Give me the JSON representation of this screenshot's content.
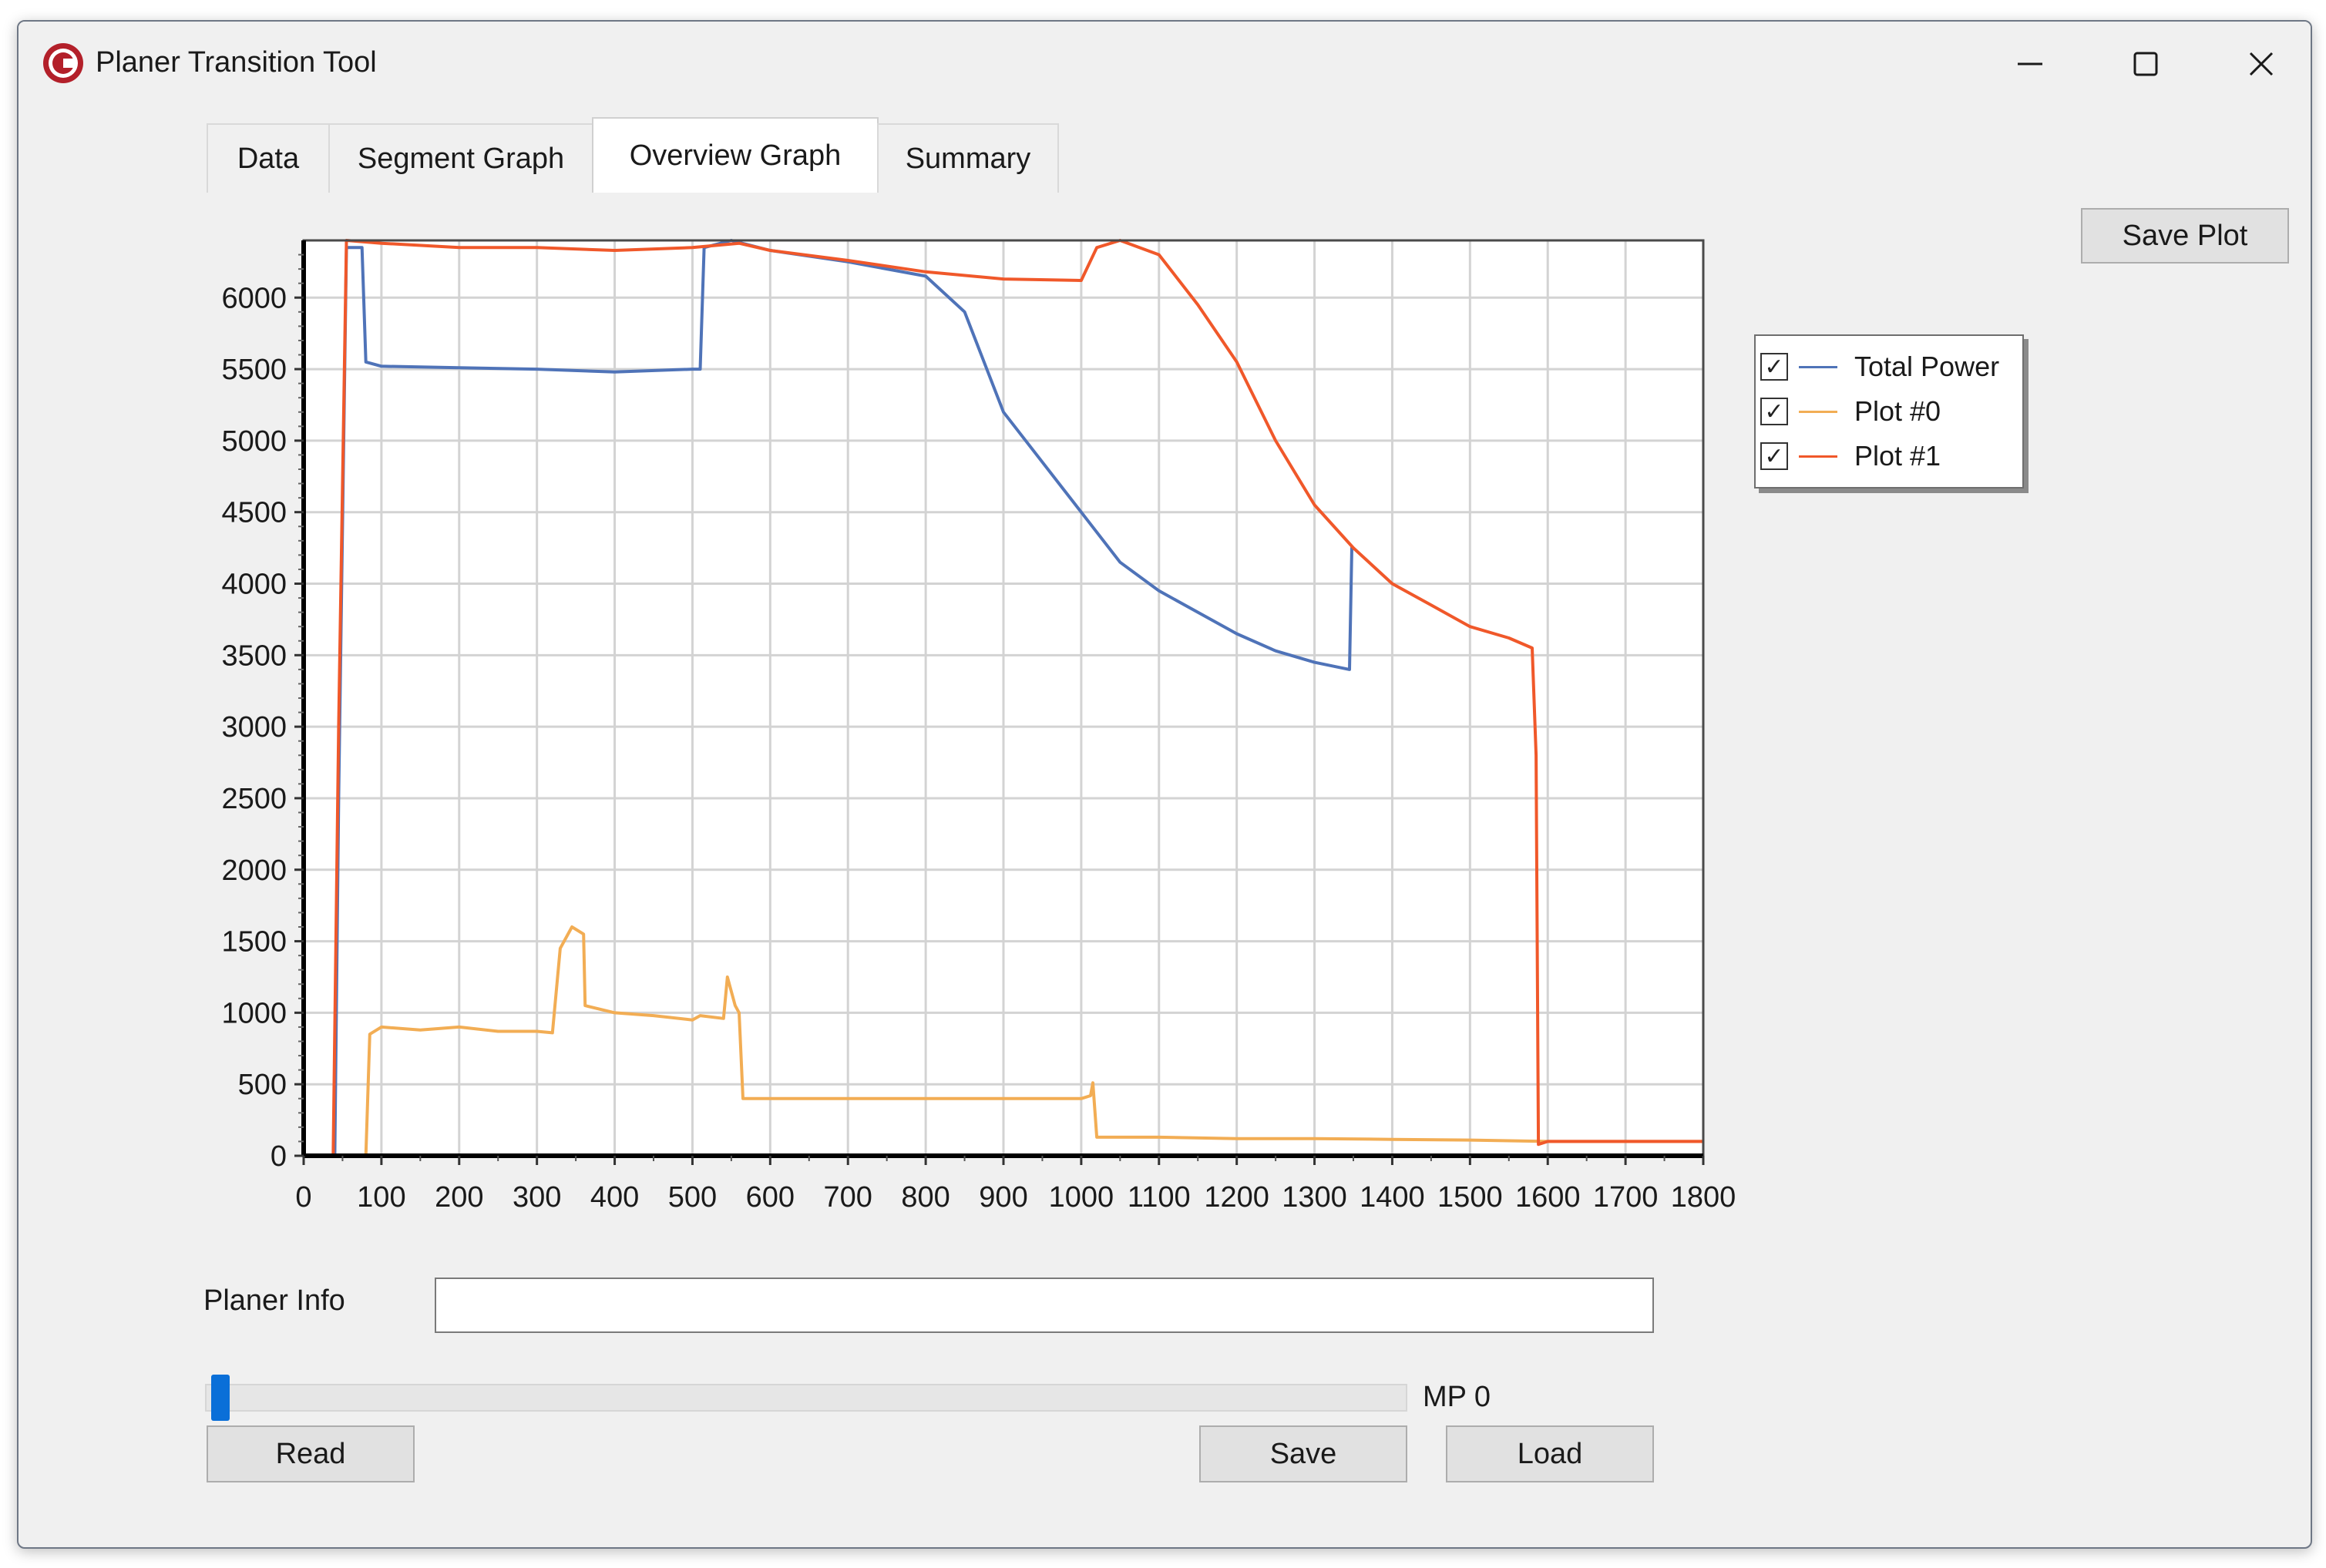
{
  "window": {
    "title": "Planer Transition Tool"
  },
  "tabs": [
    {
      "label": "Data",
      "active": false
    },
    {
      "label": "Segment Graph",
      "active": false
    },
    {
      "label": "Overview Graph",
      "active": true
    },
    {
      "label": "Summary",
      "active": false
    }
  ],
  "toolbar": {
    "save_plot_label": "Save Plot"
  },
  "legend": {
    "items": [
      {
        "label": "Total Power",
        "checked": true,
        "color": "#4f73b8"
      },
      {
        "label": "Plot #0",
        "checked": true,
        "color": "#f2ad54"
      },
      {
        "label": "Plot #1",
        "checked": true,
        "color": "#f0582a"
      }
    ]
  },
  "chart_data": {
    "type": "line",
    "title": "",
    "xlabel": "",
    "ylabel": "",
    "xlim": [
      0,
      1800
    ],
    "ylim": [
      0,
      6400
    ],
    "x_ticks": [
      0,
      100,
      200,
      300,
      400,
      500,
      600,
      700,
      800,
      900,
      1000,
      1100,
      1200,
      1300,
      1400,
      1500,
      1600,
      1700,
      1800
    ],
    "y_ticks": [
      0,
      500,
      1000,
      1500,
      2000,
      2500,
      3000,
      3500,
      4000,
      4500,
      5000,
      5500,
      6000
    ],
    "grid": true,
    "legend_position": "right",
    "series": [
      {
        "name": "Total Power",
        "color": "#4f73b8",
        "points": [
          [
            0,
            0
          ],
          [
            40,
            0
          ],
          [
            45,
            2500
          ],
          [
            55,
            6350
          ],
          [
            75,
            6350
          ],
          [
            80,
            5550
          ],
          [
            100,
            5520
          ],
          [
            200,
            5510
          ],
          [
            300,
            5500
          ],
          [
            400,
            5480
          ],
          [
            500,
            5500
          ],
          [
            510,
            5500
          ],
          [
            515,
            6350
          ],
          [
            550,
            6400
          ],
          [
            600,
            6330
          ],
          [
            700,
            6250
          ],
          [
            800,
            6150
          ],
          [
            850,
            5900
          ],
          [
            900,
            5200
          ],
          [
            950,
            4850
          ],
          [
            1000,
            4500
          ],
          [
            1050,
            4150
          ],
          [
            1100,
            3950
          ],
          [
            1150,
            3800
          ],
          [
            1200,
            3650
          ],
          [
            1250,
            3530
          ],
          [
            1300,
            3450
          ],
          [
            1345,
            3400
          ],
          [
            1348,
            4250
          ],
          [
            1350,
            4250
          ]
        ]
      },
      {
        "name": "Plot #0",
        "color": "#f2ad54",
        "points": [
          [
            0,
            0
          ],
          [
            80,
            0
          ],
          [
            85,
            850
          ],
          [
            100,
            900
          ],
          [
            150,
            880
          ],
          [
            200,
            900
          ],
          [
            250,
            870
          ],
          [
            300,
            870
          ],
          [
            320,
            860
          ],
          [
            330,
            1450
          ],
          [
            345,
            1600
          ],
          [
            360,
            1550
          ],
          [
            362,
            1050
          ],
          [
            400,
            1000
          ],
          [
            450,
            980
          ],
          [
            500,
            950
          ],
          [
            510,
            980
          ],
          [
            540,
            960
          ],
          [
            545,
            1250
          ],
          [
            555,
            1050
          ],
          [
            560,
            1000
          ],
          [
            565,
            400
          ],
          [
            600,
            400
          ],
          [
            700,
            400
          ],
          [
            800,
            400
          ],
          [
            900,
            400
          ],
          [
            1000,
            400
          ],
          [
            1012,
            420
          ],
          [
            1015,
            510
          ],
          [
            1020,
            130
          ],
          [
            1100,
            130
          ],
          [
            1200,
            120
          ],
          [
            1300,
            120
          ],
          [
            1400,
            115
          ],
          [
            1500,
            110
          ],
          [
            1600,
            100
          ],
          [
            1700,
            100
          ],
          [
            1800,
            100
          ]
        ]
      },
      {
        "name": "Plot #1",
        "color": "#f0582a",
        "points": [
          [
            0,
            0
          ],
          [
            38,
            0
          ],
          [
            45,
            3000
          ],
          [
            55,
            6400
          ],
          [
            100,
            6380
          ],
          [
            200,
            6350
          ],
          [
            300,
            6350
          ],
          [
            400,
            6330
          ],
          [
            500,
            6350
          ],
          [
            560,
            6380
          ],
          [
            600,
            6330
          ],
          [
            700,
            6260
          ],
          [
            800,
            6180
          ],
          [
            900,
            6130
          ],
          [
            1000,
            6120
          ],
          [
            1020,
            6350
          ],
          [
            1050,
            6400
          ],
          [
            1100,
            6300
          ],
          [
            1150,
            5950
          ],
          [
            1200,
            5550
          ],
          [
            1250,
            5000
          ],
          [
            1300,
            4550
          ],
          [
            1350,
            4250
          ],
          [
            1400,
            4000
          ],
          [
            1450,
            3850
          ],
          [
            1500,
            3700
          ],
          [
            1550,
            3620
          ],
          [
            1580,
            3550
          ],
          [
            1585,
            2800
          ],
          [
            1588,
            80
          ],
          [
            1600,
            100
          ],
          [
            1700,
            100
          ],
          [
            1800,
            100
          ]
        ]
      }
    ]
  },
  "planer_info": {
    "label": "Planer Info",
    "value": ""
  },
  "progress": {
    "label": "MP 0",
    "value": 0
  },
  "buttons": {
    "read": "Read",
    "save": "Save",
    "load": "Load"
  }
}
